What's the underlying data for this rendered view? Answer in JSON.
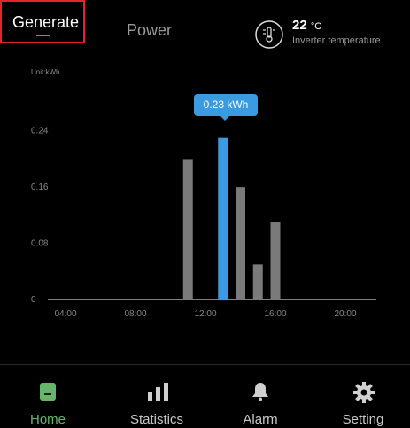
{
  "tabs": [
    {
      "label": "Generate"
    },
    {
      "label": "Power"
    }
  ],
  "temperature": {
    "value": "22",
    "unit": "°C",
    "label": "Inverter temperature"
  },
  "chart_data": {
    "type": "bar",
    "unit_label": "Unit:kWh",
    "x_ticks": [
      "04:00",
      "08:00",
      "12:00",
      "16:00",
      "20:00"
    ],
    "y_ticks": [
      "0",
      "0.08",
      "0.16",
      "0.24"
    ],
    "ylim": [
      0,
      0.28
    ],
    "bars": [
      {
        "hour": 11,
        "value": 0.2
      },
      {
        "hour": 13,
        "value": 0.23,
        "highlight": true
      },
      {
        "hour": 14,
        "value": 0.16
      },
      {
        "hour": 15,
        "value": 0.05
      },
      {
        "hour": 16,
        "value": 0.11
      }
    ],
    "tooltip": "0.23 kWh",
    "colors": {
      "bar": "#7a7a7a",
      "highlight": "#3a9be0",
      "axis": "#ffffff"
    }
  },
  "nav": [
    {
      "label": "Home",
      "icon": "home-icon"
    },
    {
      "label": "Statistics",
      "icon": "statistics-icon"
    },
    {
      "label": "Alarm",
      "icon": "bell-icon"
    },
    {
      "label": "Setting",
      "icon": "gear-icon"
    }
  ]
}
